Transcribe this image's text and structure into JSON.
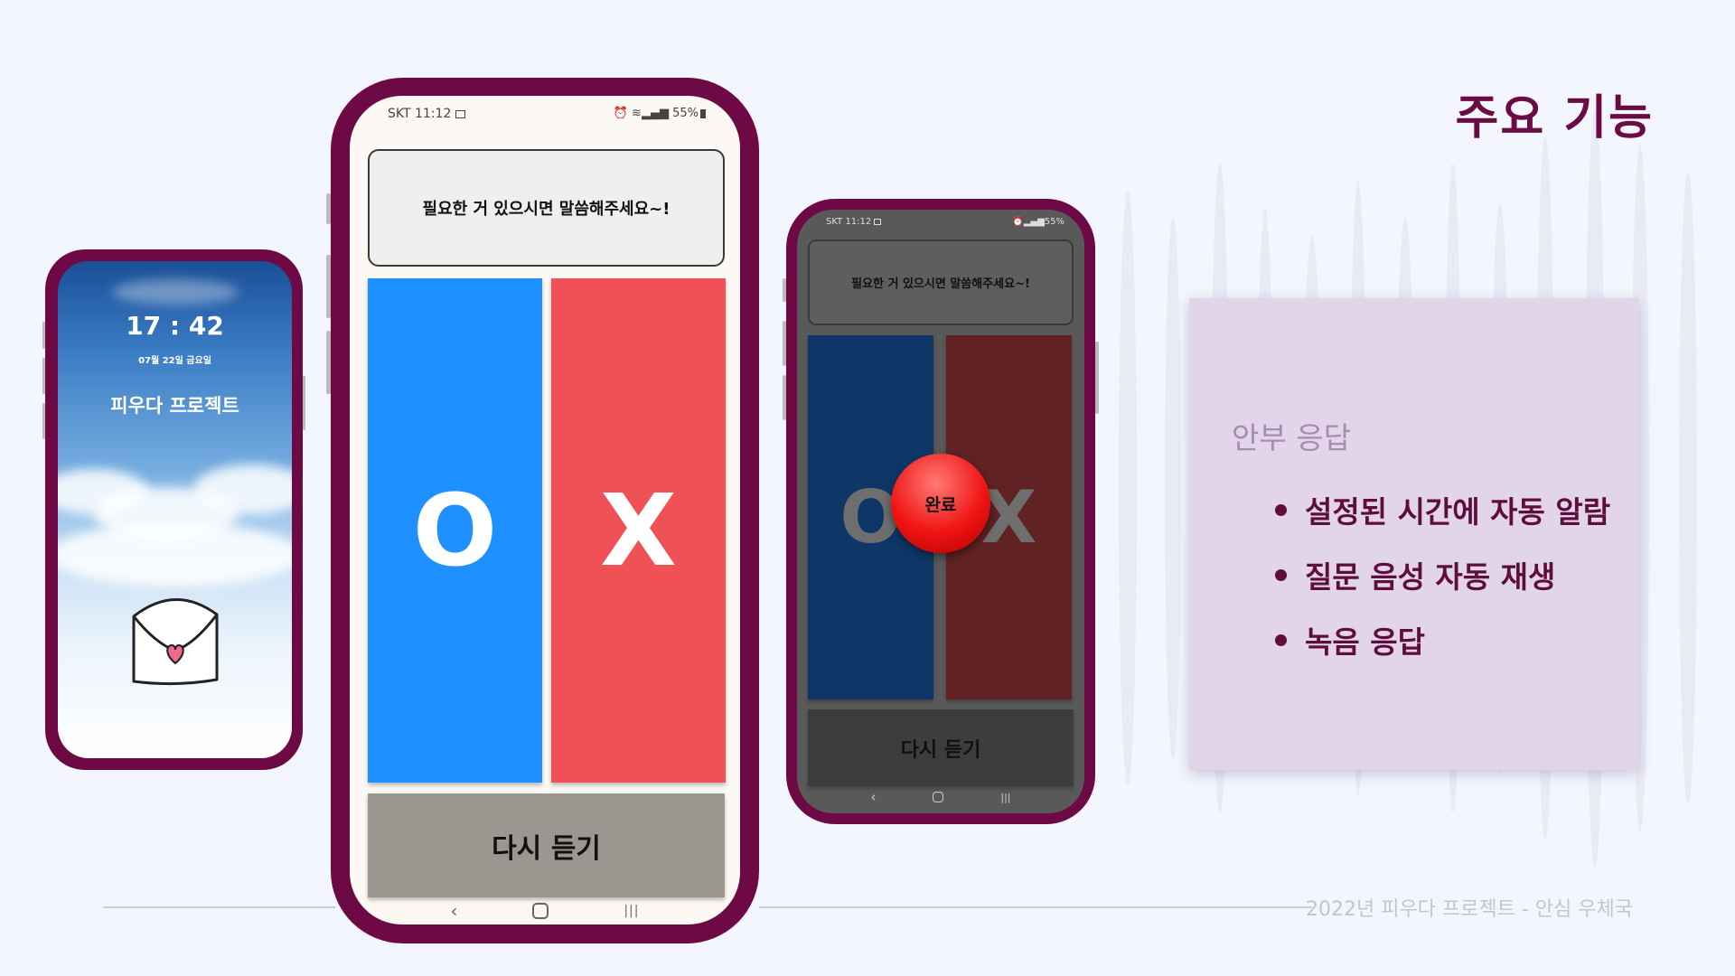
{
  "slide": {
    "title": "주요 기능",
    "footer": "2022년 피우다 프로젝트 - 안심 우체국"
  },
  "info_card": {
    "heading": "안부 응답",
    "items": [
      "설정된 시간에 자동 알람",
      "질문 음성 자동 재생",
      "녹음 응답"
    ]
  },
  "lock_screen": {
    "time": "17 : 42",
    "date": "07월 22일 금요일",
    "app_name": "피우다 프로젝트"
  },
  "app_screen": {
    "carrier": "SKT",
    "clock": "11:12",
    "battery": "55%",
    "prompt": "필요한 거 있으시면 말씀해주세요~!",
    "o_label": "O",
    "x_label": "X",
    "replay_label": "다시 듣기"
  },
  "dim_screen": {
    "carrier": "SKT",
    "clock": "11:12",
    "battery": "55%",
    "prompt": "필요한 거 있으시면 말씀해주세요~!",
    "o_label": "O",
    "x_label": "X",
    "replay_label": "다시 듣기",
    "done_label": "완료"
  },
  "colors": {
    "accent": "#6d0a45",
    "o_button": "#1e90ff",
    "x_button": "#f05156",
    "replay_button": "#9a9690",
    "o_button_dim": "#0e3768",
    "x_button_dim": "#612223",
    "replay_button_dim": "#3d3d3d"
  }
}
